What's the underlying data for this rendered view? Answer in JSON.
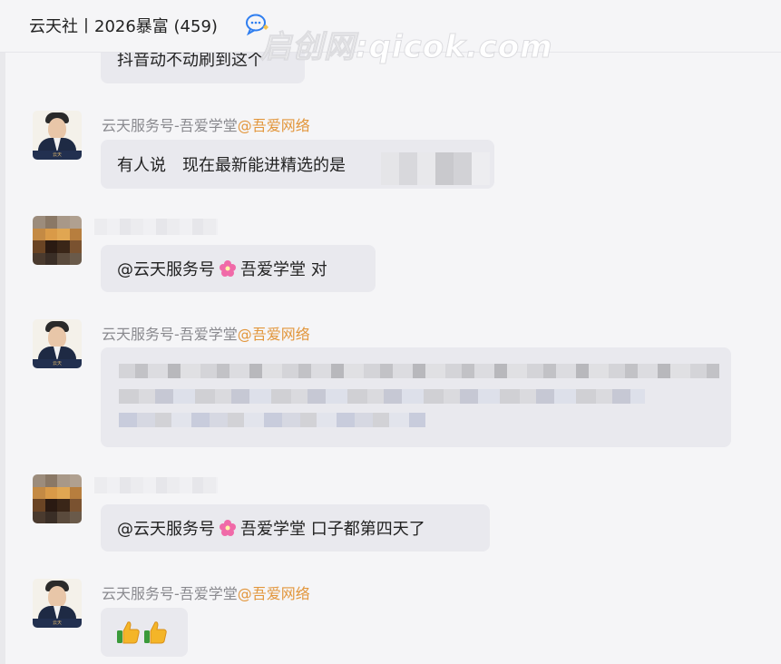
{
  "header": {
    "title": "云天社丨2026暴富 (459)",
    "watermark": "启创网:qicok.com"
  },
  "messages": [
    {
      "text_partial": "抖音动不动刷到这个"
    },
    {
      "sender_name": "云天服务号-吾爱学堂",
      "sender_at": "@吾爱网络",
      "text": "有人说　现在最新能进精选的是"
    },
    {
      "mention": "@云天服务号",
      "mention_suffix": "吾爱学堂 对"
    },
    {
      "sender_name": "云天服务号-吾爱学堂",
      "sender_at": "@吾爱网络"
    },
    {
      "mention": "@云天服务号",
      "mention_suffix": "吾爱学堂 口子都第四天了"
    },
    {
      "sender_name": "云天服务号-吾爱学堂",
      "sender_at": "@吾爱网络",
      "emoji": "thumbs-up-icon"
    }
  ],
  "avatars": {
    "portrait_caption": "云天"
  },
  "colors": {
    "at_color": "#e2963c",
    "bubble": "#e9e9ee"
  }
}
